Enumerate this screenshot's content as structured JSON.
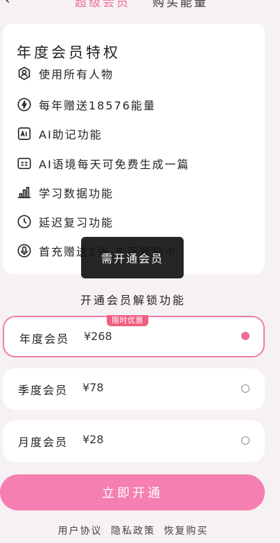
{
  "header": {
    "back_icon": "chevron-left-icon",
    "tabs": [
      {
        "label": "超级会员",
        "active": true
      },
      {
        "label": "购买能量",
        "active": false
      }
    ]
  },
  "privileges": {
    "title": "年度会员特权",
    "items": [
      {
        "icon": "person-badge-icon",
        "label": "使用所有人物"
      },
      {
        "icon": "bolt-circle-icon",
        "label": "每年赠送18576能量"
      },
      {
        "icon": "ai-box-icon",
        "label": "AI助记功能"
      },
      {
        "icon": "scene-card-icon",
        "label": "AI语境每天可免费生成一篇"
      },
      {
        "icon": "bar-chart-icon",
        "label": "学习数据功能"
      },
      {
        "icon": "clock-icon",
        "label": "延迟复习功能"
      },
      {
        "icon": "microphone-icon",
        "label": "首充赠送2张 丰声复刻卡"
      }
    ]
  },
  "toast": "需开通会员",
  "unlock_title": "开通会员解锁功能",
  "plans": [
    {
      "name": "年度会员",
      "price": "¥268",
      "badge": "限时优惠",
      "selected": true
    },
    {
      "name": "季度会员",
      "price": "¥78",
      "selected": false
    },
    {
      "name": "月度会员",
      "price": "¥28",
      "selected": false
    }
  ],
  "cta": "立即开通",
  "footer": {
    "links": [
      "用户协议",
      "隐私政策",
      "恢复购买"
    ]
  },
  "colors": {
    "accent": "#f47fb0",
    "badge": "#f05f80",
    "background": "#f6f1f3"
  }
}
